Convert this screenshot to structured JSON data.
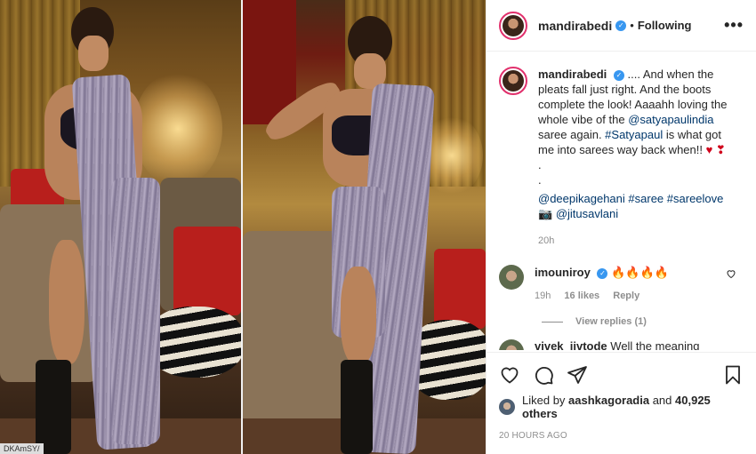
{
  "post": {
    "username": "mandirabedi",
    "verified_mark": "✓",
    "separator": "•",
    "follow_status": "Following",
    "more_label": "•••",
    "watermark": "DKAmSY/"
  },
  "caption": {
    "username": "mandirabedi",
    "line1": ".... And when the pleats fall just right. And the boots complete the look! Aaaahh loving the whole vibe of the ",
    "mention1": "@satyapaulindia",
    "line2": " saree again. ",
    "hashtag1": "#Satyapaul",
    "line3": " is what got me into sarees way back when!! ",
    "hearts": "♥ ❣",
    "dot1": ".",
    "dot2": ".",
    "mention2": "@deepikagehani",
    "hashtag2": "#saree",
    "hashtag3": "#sareelove",
    "camera": "📷",
    "mention3": "@jitusavlani",
    "time": "20h"
  },
  "comments": [
    {
      "username": "imouniroy",
      "text": "🔥🔥🔥🔥",
      "time": "19h",
      "likes": "16 likes",
      "reply": "Reply",
      "view_replies": "View replies (1)"
    },
    {
      "username": "vivek_jivtode",
      "text": "Well the meaning"
    }
  ],
  "footer": {
    "liked_prefix": "Liked by ",
    "liked_user": "aashkagoradia",
    "liked_mid": " and ",
    "liked_count": "40,925 others",
    "ago": "20 HOURS AGO"
  },
  "icons": [
    "heart-icon",
    "comment-icon",
    "share-icon",
    "bookmark-icon",
    "verified-icon",
    "more-icon"
  ],
  "colors": {
    "link": "#00376b",
    "verified": "#3897f0",
    "meta": "#8e8e8e",
    "heart": "#d0021b"
  }
}
